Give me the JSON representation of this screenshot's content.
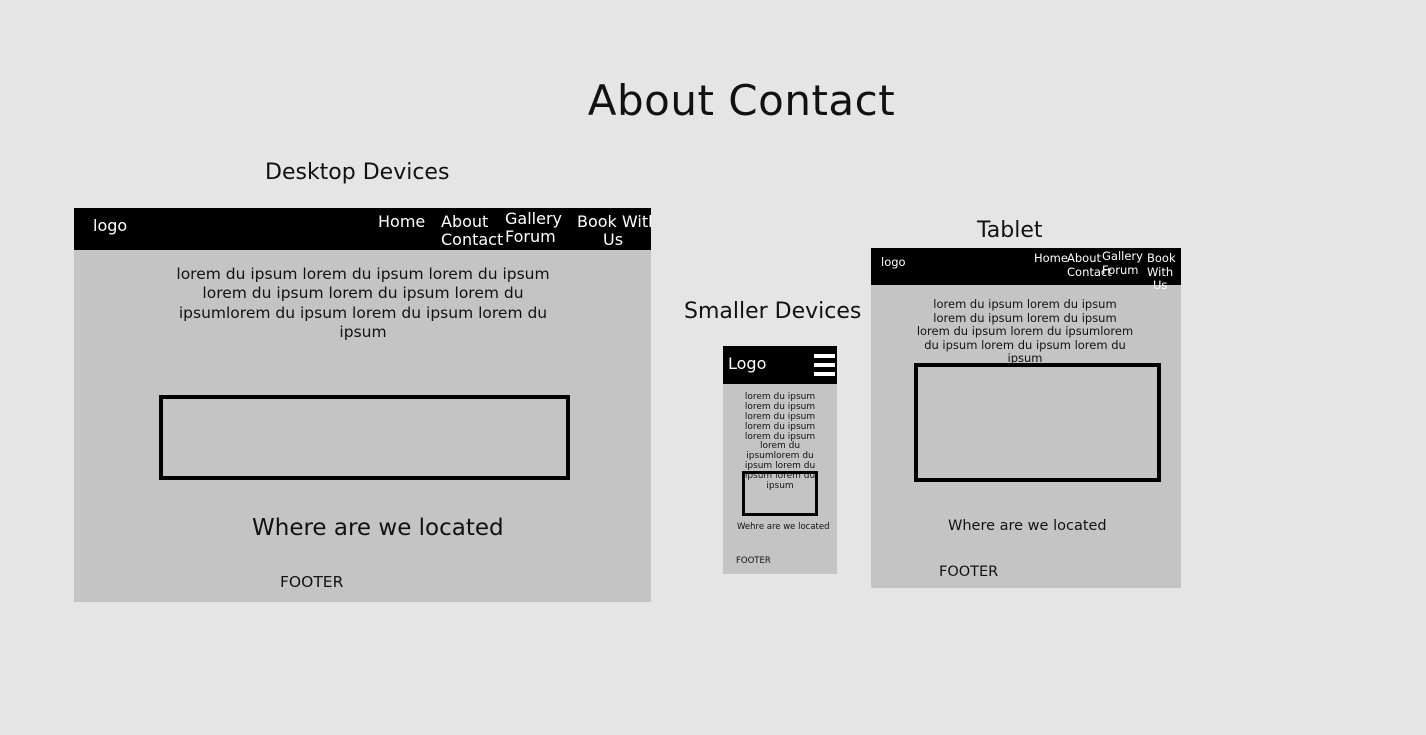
{
  "title": "About Contact",
  "desktop": {
    "label": "Desktop Devices",
    "logo": "logo",
    "nav": {
      "home": "Home",
      "about": "About",
      "contact": "Contact",
      "gallery": "Gallery",
      "forum": "Forum",
      "book_line1": "Book With",
      "book_line2": "Us"
    },
    "lorem": "lorem du ipsum lorem du ipsum lorem du ipsum lorem du ipsum lorem du ipsum lorem du ipsumlorem du ipsum lorem du ipsum lorem du ipsum",
    "where": "Where are we located",
    "footer": "FOOTER"
  },
  "mobile": {
    "label": "Smaller Devices",
    "logo": "Logo",
    "menu_icon": "hamburger-menu-icon",
    "lorem": "lorem du ipsum lorem du ipsum lorem du ipsum lorem du ipsum lorem du ipsum lorem du ipsumlorem du ipsum lorem du ipsum lorem du ipsum",
    "where": "Wehre are we located",
    "footer": "FOOTER"
  },
  "tablet": {
    "label": "Tablet",
    "logo": "logo",
    "nav": {
      "home": "Home",
      "about": "About",
      "contact": "Contact",
      "gallery": "Gallery",
      "forum": "Forum",
      "book_line1": "Book",
      "book_line2": "With",
      "book_line3": "Us"
    },
    "lorem": "lorem du ipsum lorem du ipsum lorem du ipsum lorem du ipsum lorem du ipsum lorem du ipsumlorem du ipsum lorem du ipsum lorem du ipsum",
    "where": "Where are we located",
    "footer": "FOOTER"
  },
  "colors": {
    "background": "#e5e5e5",
    "frame": "#c4c4c4",
    "navbar": "#000000",
    "text": "#111111"
  }
}
